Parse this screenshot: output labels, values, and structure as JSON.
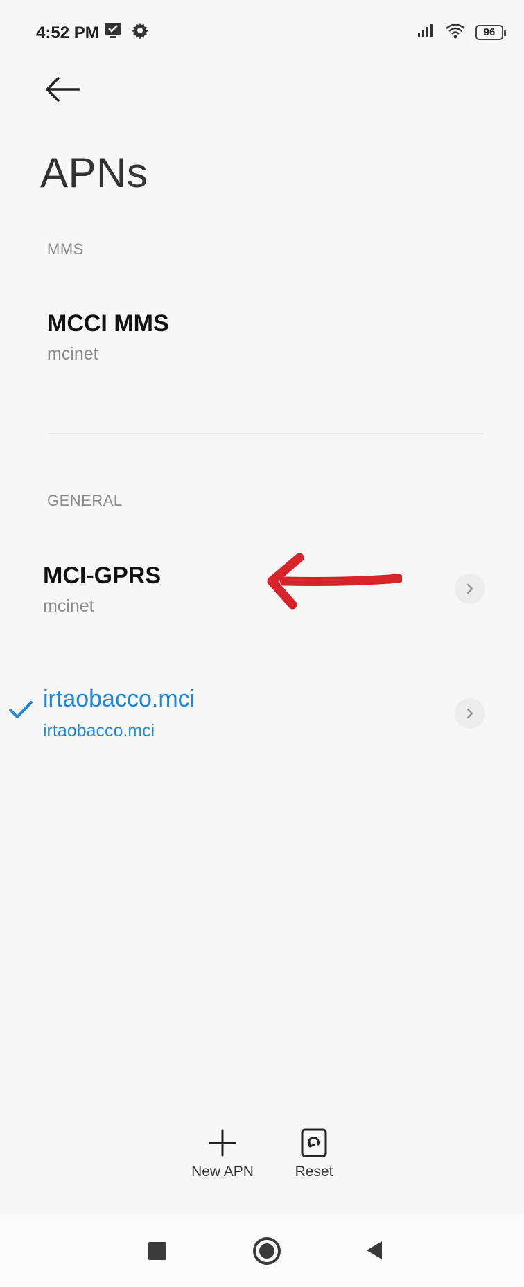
{
  "status_bar": {
    "time": "4:52 PM",
    "battery": "96",
    "left_icons": [
      "screen-cast-icon",
      "settings-gear-icon"
    ],
    "right_icons": [
      "signal-icon",
      "wifi-icon",
      "battery-icon"
    ]
  },
  "header": {
    "title": "APNs"
  },
  "sections": [
    {
      "label": "MMS",
      "items": [
        {
          "name": "MCCI MMS",
          "sub": "mcinet",
          "selected": false
        }
      ]
    },
    {
      "label": "GENERAL",
      "items": [
        {
          "name": "MCI-GPRS",
          "sub": "mcinet",
          "selected": false
        },
        {
          "name": "irtaobacco.mci",
          "sub": "irtaobacco.mci",
          "selected": true
        }
      ]
    }
  ],
  "actions": {
    "new_apn": "New APN",
    "reset": "Reset"
  },
  "colors": {
    "accent": "#1f87d6",
    "annotation_arrow": "#d8232a"
  }
}
